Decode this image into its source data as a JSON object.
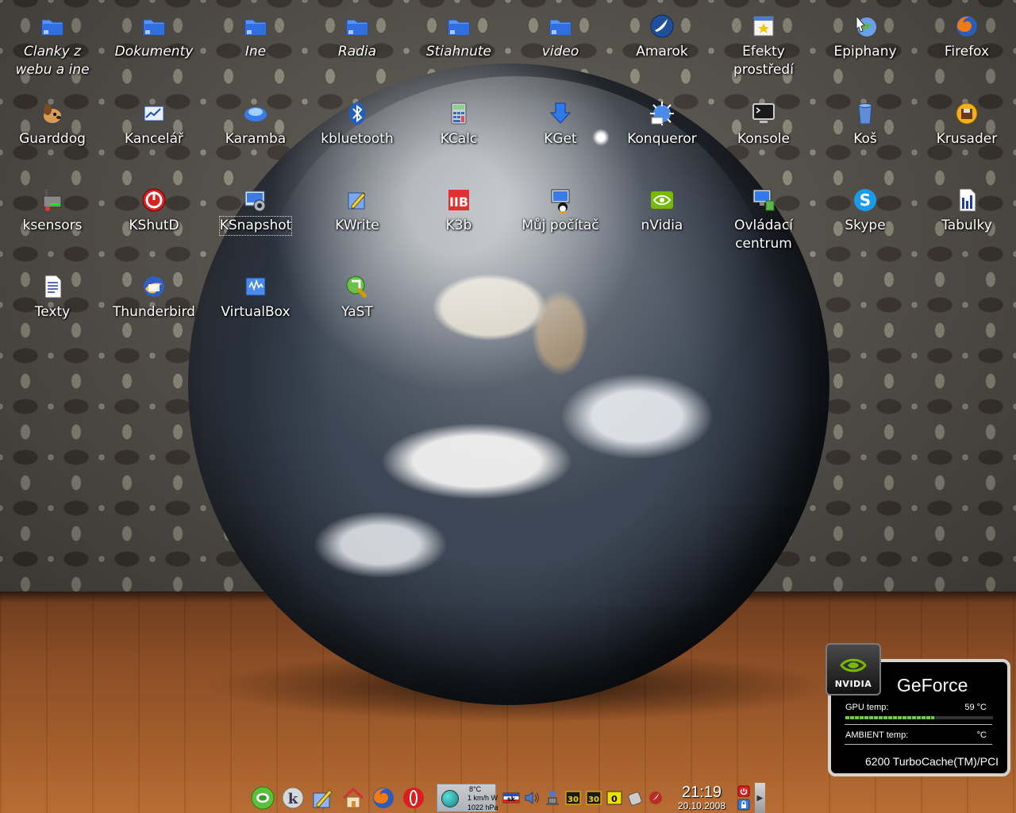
{
  "desktop_icons": [
    {
      "label": "Clanky z\nwebu a ine",
      "icon": "folder-icon",
      "italic": true
    },
    {
      "label": "Dokumenty",
      "icon": "folder-icon",
      "italic": true
    },
    {
      "label": "Ine",
      "icon": "folder-icon",
      "italic": true
    },
    {
      "label": "Radia",
      "icon": "folder-icon",
      "italic": true
    },
    {
      "label": "Stiahnute",
      "icon": "folder-icon",
      "italic": true
    },
    {
      "label": "video",
      "icon": "folder-icon",
      "italic": true
    },
    {
      "label": "Amarok",
      "icon": "amarok-icon",
      "italic": false
    },
    {
      "label": "Efekty\nprostředí",
      "icon": "desktop-effects-icon",
      "italic": false
    },
    {
      "label": "Epiphany",
      "icon": "epiphany-icon",
      "italic": false
    },
    {
      "label": "Firefox",
      "icon": "firefox-icon",
      "italic": false
    },
    {
      "label": "Guarddog",
      "icon": "guarddog-icon",
      "italic": false
    },
    {
      "label": "Kancelář",
      "icon": "office-icon",
      "italic": false
    },
    {
      "label": "Karamba",
      "icon": "karamba-icon",
      "italic": false
    },
    {
      "label": "kbluetooth",
      "icon": "bluetooth-icon",
      "italic": false
    },
    {
      "label": "KCalc",
      "icon": "calculator-icon",
      "italic": false
    },
    {
      "label": "KGet",
      "icon": "download-icon",
      "italic": false
    },
    {
      "label": "Konqueror",
      "icon": "konqueror-icon",
      "italic": false
    },
    {
      "label": "Konsole",
      "icon": "terminal-icon",
      "italic": false
    },
    {
      "label": "Koš",
      "icon": "trash-icon",
      "italic": false
    },
    {
      "label": "Krusader",
      "icon": "krusader-icon",
      "italic": false
    },
    {
      "label": "ksensors",
      "icon": "sensors-icon",
      "italic": false
    },
    {
      "label": "KShutD",
      "icon": "shutdown-icon",
      "italic": false
    },
    {
      "label": "KSnapshot",
      "icon": "camera-icon",
      "italic": false,
      "selected": true
    },
    {
      "label": "KWrite",
      "icon": "text-editor-icon",
      "italic": false
    },
    {
      "label": "K3b",
      "icon": "k3b-icon",
      "italic": false
    },
    {
      "label": "Můj počítač",
      "icon": "computer-icon",
      "italic": false
    },
    {
      "label": "nVidia",
      "icon": "nvidia-icon",
      "italic": false
    },
    {
      "label": "Ovládací\ncentrum",
      "icon": "control-center-icon",
      "italic": false
    },
    {
      "label": "Skype",
      "icon": "skype-icon",
      "italic": false
    },
    {
      "label": "Tabulky",
      "icon": "spreadsheet-icon",
      "italic": false
    },
    {
      "label": "Texty",
      "icon": "document-icon",
      "italic": false
    },
    {
      "label": "Thunderbird",
      "icon": "thunderbird-icon",
      "italic": false
    },
    {
      "label": "VirtualBox",
      "icon": "virtualbox-icon",
      "italic": false
    },
    {
      "label": "YaST",
      "icon": "yast-icon",
      "italic": false
    }
  ],
  "nvidia_widget": {
    "brand": "NVIDIA",
    "title": "GeForce",
    "gpu_label": "GPU temp:",
    "gpu_value": "59 °C",
    "gpu_level": 0.6,
    "ambient_label": "AMBIENT temp:",
    "ambient_value": "°C",
    "card_name": "6200 TurboCache(TM)/PCI"
  },
  "taskbar": {
    "launchers": [
      "suse-menu-icon",
      "kde-icon",
      "kwrite-icon",
      "home-icon",
      "firefox-icon",
      "opera-icon"
    ],
    "weather": {
      "temp": "8°C",
      "wind": "1 km/h W",
      "pressure": "1022 hPa"
    },
    "tray_icons": [
      "keyboard-layout-icon",
      "speaker-icon",
      "network-icon",
      "calendar-30-icon",
      "calendar-30b-icon",
      "counter-0-icon",
      "klipper-icon",
      "amarok-tray-icon"
    ],
    "clock": {
      "time": "21:19",
      "date": "20.10.2008"
    }
  },
  "colors": {
    "folder": "#2f6fe0",
    "nvidia_green": "#76b900"
  }
}
